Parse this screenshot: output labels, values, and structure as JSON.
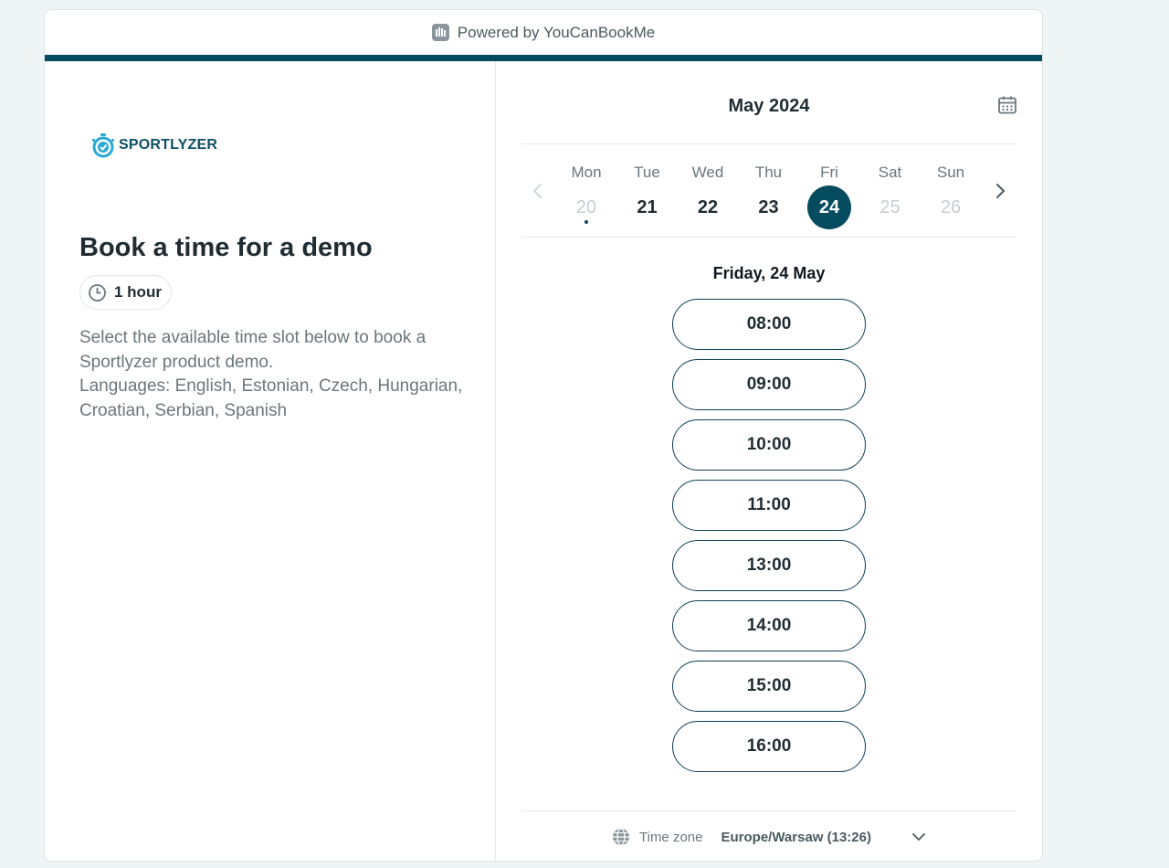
{
  "header": {
    "powered_by": "Powered by YouCanBookMe"
  },
  "brand": {
    "logo_text": "SPORTLYZER"
  },
  "booking": {
    "title": "Book a time for a demo",
    "duration": "1 hour",
    "description": "Select the available time slot below to book a Sportlyzer product demo.",
    "languages": "Languages: English, Estonian, Czech, Hungarian, Croatian, Serbian, Spanish"
  },
  "calendar": {
    "month": "May 2024",
    "days": [
      {
        "name": "Mon",
        "date": "20",
        "state": "disabled",
        "today_marker": true
      },
      {
        "name": "Tue",
        "date": "21",
        "state": "available"
      },
      {
        "name": "Wed",
        "date": "22",
        "state": "available"
      },
      {
        "name": "Thu",
        "date": "23",
        "state": "available"
      },
      {
        "name": "Fri",
        "date": "24",
        "state": "selected"
      },
      {
        "name": "Sat",
        "date": "25",
        "state": "disabled"
      },
      {
        "name": "Sun",
        "date": "26",
        "state": "disabled"
      }
    ],
    "selected_date_label": "Friday, 24 May"
  },
  "slots": [
    "08:00",
    "09:00",
    "10:00",
    "11:00",
    "13:00",
    "14:00",
    "15:00",
    "16:00"
  ],
  "timezone": {
    "label": "Time zone",
    "value": "Europe/Warsaw (13:26)"
  },
  "colors": {
    "accent": "#044b5f",
    "brand": "#0f4f66",
    "brand_icon": "#29a9d6",
    "background": "#eff4f5"
  }
}
